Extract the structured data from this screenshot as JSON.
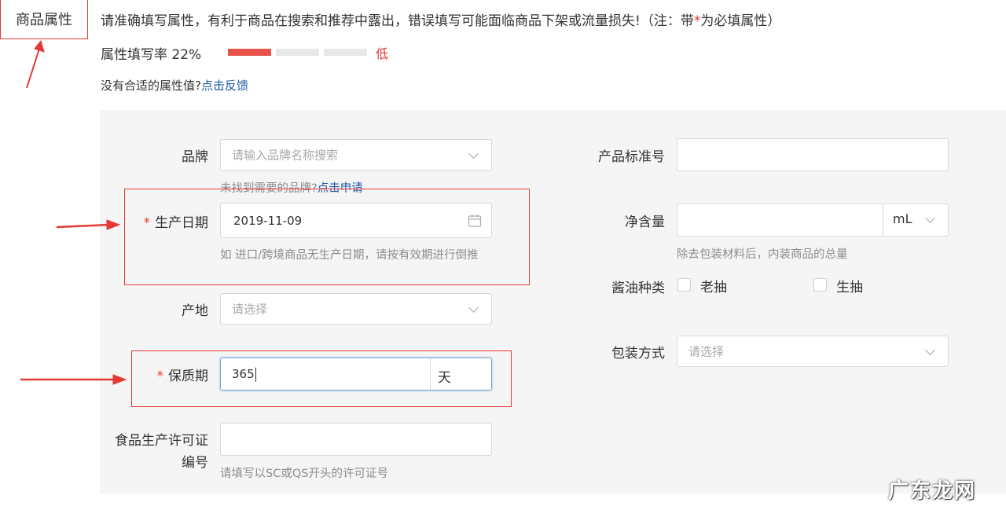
{
  "header": {
    "section_title": "商品属性",
    "notice_text": "请准确填写属性，有利于商品在搜索和推荐中露出，错误填写可能面临商品下架或流量损失!（注：带",
    "notice_star": "*",
    "notice_suffix": "为必填属性）",
    "fill_rate_label": "属性填写率 22%",
    "fill_rate_percent": 22,
    "fill_rate_level": "低",
    "feedback_text": "没有合适的属性值?",
    "feedback_link": "点击反馈"
  },
  "form": {
    "brand": {
      "label": "品牌",
      "placeholder": "请输入品牌名称搜索",
      "help_text": "未找到需要的品牌?",
      "help_link": "点击申请"
    },
    "production_date": {
      "label": "生产日期",
      "required_mark": "*",
      "value": "2019-11-09",
      "help_text": "如 进口/跨境商品无生产日期，请按有效期进行倒推"
    },
    "origin": {
      "label": "产地",
      "placeholder": "请选择"
    },
    "shelf_life": {
      "label": "保质期",
      "required_mark": "*",
      "value": "365",
      "unit": "天"
    },
    "food_license": {
      "label_line1": "食品生产许可证",
      "label_line2": "编号",
      "value": "",
      "help_text": "请填写以SC或QS开头的许可证号"
    },
    "standard_no": {
      "label": "产品标准号",
      "value": ""
    },
    "net_content": {
      "label": "净含量",
      "value": "",
      "unit": "mL",
      "help_text": "除去包装材料后，内装商品的总量"
    },
    "soy_type": {
      "label": "酱油种类",
      "options": [
        "老抽",
        "生抽"
      ]
    },
    "packaging": {
      "label": "包装方式",
      "placeholder": "请选择"
    }
  },
  "watermark": "广东龙网",
  "colors": {
    "accent_red": "#e53935",
    "link_blue": "#1e58a8",
    "focus_blue": "#7aa3d4"
  }
}
